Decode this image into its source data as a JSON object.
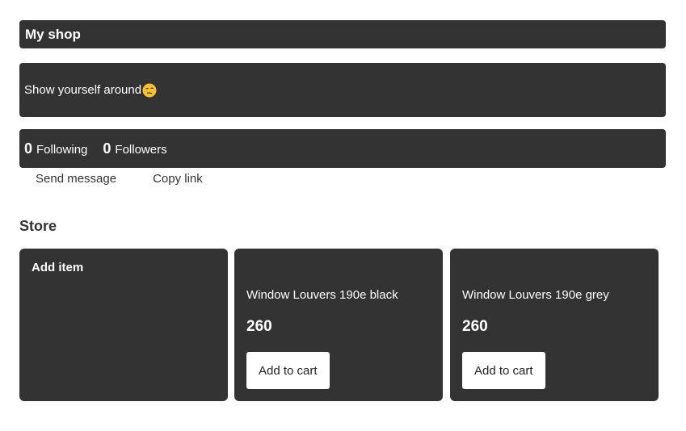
{
  "header": {
    "title": "My shop"
  },
  "bio": {
    "text": "Show yourself around",
    "emoji_icon": "face-emoji-icon"
  },
  "stats": {
    "following_count": "0",
    "following_label": "Following",
    "followers_count": "0",
    "followers_label": "Followers"
  },
  "actions": {
    "send_message": "Send message",
    "copy_link": "Copy link"
  },
  "store": {
    "heading": "Store",
    "add_item_label": "Add item",
    "products": [
      {
        "name": "Window Louvers 190e black",
        "price": "260",
        "button": "Add to cart"
      },
      {
        "name": "Window Louvers 190e grey",
        "price": "260",
        "button": "Add to cart"
      }
    ]
  },
  "colors": {
    "panel": "#333333",
    "text_on_panel": "#ffffff",
    "button_bg": "#ffffff"
  }
}
